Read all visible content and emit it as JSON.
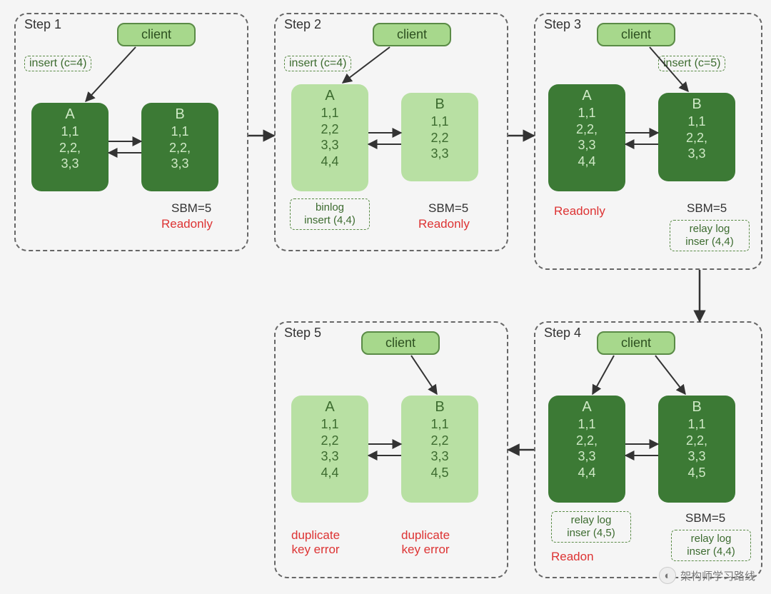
{
  "labels": {
    "client": "client",
    "step1": "Step 1",
    "step2": "Step 2",
    "step3": "Step 3",
    "step4": "Step 4",
    "step5": "Step 5",
    "sbm5": "SBM=5",
    "readonly": "Readonly",
    "readonly_cut": "Readon",
    "dup_err1": "duplicate",
    "dup_err2": "key error"
  },
  "inserts": {
    "c4": "insert (c=4)",
    "c5": "insert (c=5)"
  },
  "boxes": {
    "binlog1": "binlog",
    "binlog2": "insert (4,4)",
    "relay44a": "relay log",
    "relay44b": "inser (4,4)",
    "relay45a": "relay log",
    "relay45b": "inser (4,5)"
  },
  "nodes": {
    "A3": {
      "name": "A",
      "rows": [
        "1,1",
        "2,2,",
        "3,3"
      ]
    },
    "B3": {
      "name": "B",
      "rows": [
        "1,1",
        "2,2,",
        "3,3"
      ]
    },
    "A4": {
      "name": "A",
      "rows": [
        "1,1",
        "2,2",
        "3,3",
        "4,4"
      ]
    },
    "B3b": {
      "name": "B",
      "rows": [
        "1,1",
        "2,2",
        "3,3"
      ]
    },
    "A4b": {
      "name": "A",
      "rows": [
        "1,1",
        "2,2,",
        "3,3",
        "4,4"
      ]
    },
    "B3c": {
      "name": "B",
      "rows": [
        "1,1",
        "2,2,",
        "3,3"
      ]
    },
    "A4c": {
      "name": "A",
      "rows": [
        "1,1",
        "2,2,",
        "3,3",
        "4,4"
      ]
    },
    "B45": {
      "name": "B",
      "rows": [
        "1,1",
        "2,2,",
        "3,3",
        "4,5"
      ]
    },
    "A4d": {
      "name": "A",
      "rows": [
        "1,1",
        "2,2",
        "3,3",
        "4,4"
      ]
    },
    "B45b": {
      "name": "B",
      "rows": [
        "1,1",
        "2,2",
        "3,3",
        "4,5"
      ]
    }
  },
  "watermark": "架构师学习路线"
}
